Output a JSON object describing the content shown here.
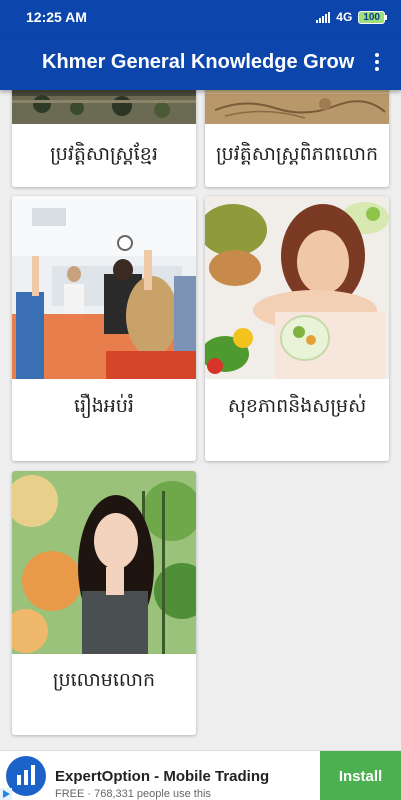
{
  "status_bar": {
    "time": "12:25 AM",
    "network": "4G",
    "battery": "100"
  },
  "app_bar": {
    "title": "Khmer General Knowledge Grow",
    "menu_icon": "more-vert-icon"
  },
  "cards": [
    {
      "label": "ប្រវត្តិសាស្ត្រខ្មែរ",
      "image": "ancient-ruins-photo"
    },
    {
      "label": "ប្រវត្តិសាស្ត្រពិភពលោក",
      "image": "old-world-map-photo"
    },
    {
      "label": "រឿងអប់រំ",
      "image": "classroom-photo"
    },
    {
      "label": "សុខភាពនិងសម្រស់",
      "image": "woman-with-salad-photo"
    },
    {
      "label": "ប្រលោមលោក",
      "image": "smiling-woman-photo"
    }
  ],
  "ad": {
    "title": "ExpertOption - Mobile Trading",
    "subtitle": "FREE · 768,331 people use this",
    "install_label": "Install"
  },
  "colors": {
    "app_bar": "#0c46ad",
    "install_button": "#4caf50",
    "ad_logo": "#1b62c9"
  }
}
